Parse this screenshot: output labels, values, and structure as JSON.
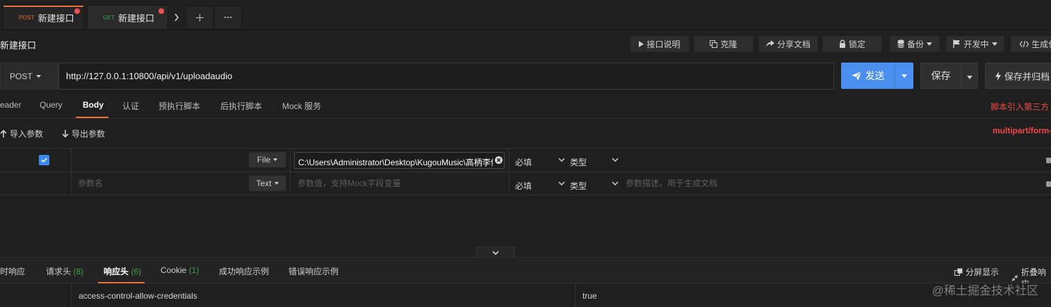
{
  "tabs": [
    {
      "method": "POST",
      "method_color": "#f0713e",
      "label": "新建接口",
      "active": true
    },
    {
      "method": "GET",
      "method_color": "#3aa35a",
      "label": "新建接口",
      "active": false
    }
  ],
  "page_title": "新建接口",
  "toolbar": {
    "doc_label": "接口说明",
    "clone_label": "克隆",
    "share_label": "分享文档",
    "lock_label": "锁定",
    "backup_label": "备份",
    "status_label": "开发中",
    "generate_label": "生成代"
  },
  "request": {
    "method": "POST",
    "url": "http://127.0.0.1:10800/api/v1/uploadaudio",
    "send_label": "发送",
    "save_label": "保存",
    "save_archive_label": "保存并归档"
  },
  "subtabs": [
    "eader",
    "Query",
    "Body",
    "认证",
    "预执行脚本",
    "后执行脚本",
    "Mock 服务"
  ],
  "script_link": "脚本引入第三方",
  "params": {
    "import_label": "导入参数",
    "export_label": "导出参数",
    "content_type": "multipart/form-",
    "rows": [
      {
        "checked": true,
        "name": "",
        "type": "File",
        "value": "C:\\Users\\Administrator\\Desktop\\KugouMusic\\高柄李依",
        "required": "必填",
        "data_type": "类型",
        "description": ""
      },
      {
        "checked": false,
        "name_placeholder": "参数名",
        "type": "Text",
        "value_placeholder": "参数值，支持Mock字段变量",
        "required": "必填",
        "data_type": "类型",
        "description_placeholder": "参数描述，用于生成文档"
      }
    ]
  },
  "response": {
    "tabs": [
      {
        "label": "时响应",
        "count": ""
      },
      {
        "label": "请求头",
        "count": "(8)"
      },
      {
        "label": "响应头",
        "count": "(6)"
      },
      {
        "label": "Cookie",
        "count": "(1)"
      },
      {
        "label": "成功响应示例",
        "count": ""
      },
      {
        "label": "错误响应示例",
        "count": ""
      }
    ],
    "split_label": "分屏显示",
    "collapse_label": "折叠响应",
    "headers": [
      {
        "key": "access-control-allow-credentials",
        "value": "true"
      }
    ]
  },
  "watermark": "@稀土掘金技术社区",
  "colors": {
    "accent": "#f0713e",
    "primary": "#4a8ff0",
    "danger": "#f04848",
    "count_green": "#43a047"
  }
}
